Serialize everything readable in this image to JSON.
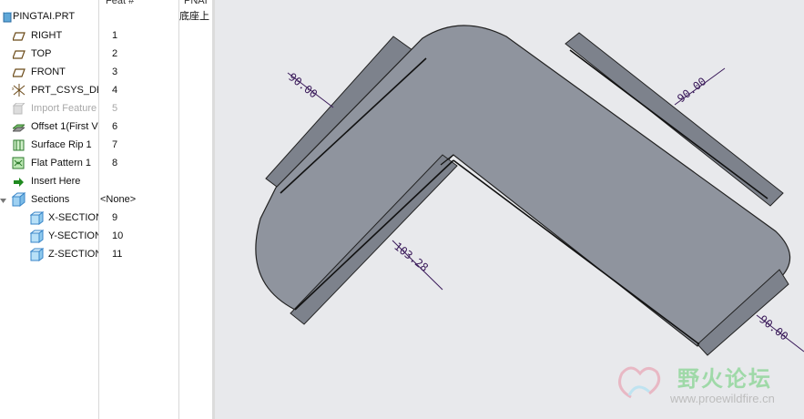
{
  "tree": {
    "columns": {
      "feat": "Feat #",
      "pname": "PNAI"
    },
    "header_suffix": "底座上",
    "root": "PINGTAI.PRT",
    "items": [
      {
        "label": "RIGHT",
        "num": "1",
        "icon": "datum-plane-icon"
      },
      {
        "label": "TOP",
        "num": "2",
        "icon": "datum-plane-icon"
      },
      {
        "label": "FRONT",
        "num": "3",
        "icon": "datum-plane-icon"
      },
      {
        "label": "PRT_CSYS_DE",
        "num": "4",
        "icon": "csys-icon"
      },
      {
        "label": "Import Feature",
        "num": "5",
        "icon": "import-feature-icon"
      },
      {
        "label": "Offset 1(First V",
        "num": "6",
        "icon": "offset-icon"
      },
      {
        "label": "Surface Rip 1",
        "num": "7",
        "icon": "surface-rip-icon"
      },
      {
        "label": "Flat Pattern 1",
        "num": "8",
        "icon": "flat-pattern-icon"
      },
      {
        "label": "Insert Here",
        "num": "",
        "icon": "insert-arrow-icon"
      },
      {
        "label": "Sections",
        "num": "<None>",
        "icon": "sections-icon"
      },
      {
        "label": "X-SECTION",
        "num": "9",
        "icon": "section-icon"
      },
      {
        "label": "Y-SECTION",
        "num": "10",
        "icon": "section-icon"
      },
      {
        "label": "Z-SECTION",
        "num": "11",
        "icon": "section-icon"
      }
    ]
  },
  "dimensions": {
    "d1": "90.00",
    "d2": "90.00",
    "d3": "103.28",
    "d4": "90.00"
  },
  "watermark": {
    "name": "野火论坛",
    "url": "www.proewildfire.cn"
  },
  "colors": {
    "part_fill": "#8f949e",
    "flange_fill": "#7f848e",
    "background": "#e8e9ec",
    "dimension": "#3a1a5a"
  }
}
